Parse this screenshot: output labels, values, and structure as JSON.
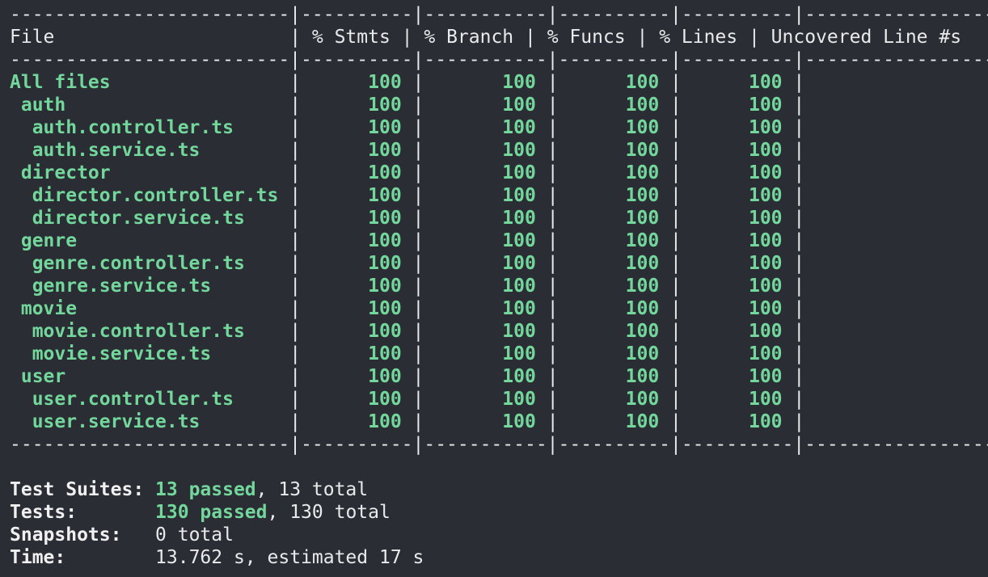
{
  "table": {
    "divider_file": "-------------------------",
    "divider_num": "----------",
    "divider_branch": "-----------",
    "divider_uncovered": "-------------------",
    "headers": {
      "file": "File",
      "stmts": "% Stmts",
      "branch": "% Branch",
      "funcs": "% Funcs",
      "lines": "% Lines",
      "uncovered": "Uncovered Line #s"
    },
    "rows": [
      {
        "file": "All files",
        "indent": 0,
        "stmts": "100",
        "branch": "100",
        "funcs": "100",
        "lines": "100",
        "uncovered": ""
      },
      {
        "file": "auth",
        "indent": 1,
        "stmts": "100",
        "branch": "100",
        "funcs": "100",
        "lines": "100",
        "uncovered": ""
      },
      {
        "file": "auth.controller.ts",
        "indent": 2,
        "stmts": "100",
        "branch": "100",
        "funcs": "100",
        "lines": "100",
        "uncovered": ""
      },
      {
        "file": "auth.service.ts",
        "indent": 2,
        "stmts": "100",
        "branch": "100",
        "funcs": "100",
        "lines": "100",
        "uncovered": ""
      },
      {
        "file": "director",
        "indent": 1,
        "stmts": "100",
        "branch": "100",
        "funcs": "100",
        "lines": "100",
        "uncovered": ""
      },
      {
        "file": "director.controller.ts",
        "indent": 2,
        "stmts": "100",
        "branch": "100",
        "funcs": "100",
        "lines": "100",
        "uncovered": ""
      },
      {
        "file": "director.service.ts",
        "indent": 2,
        "stmts": "100",
        "branch": "100",
        "funcs": "100",
        "lines": "100",
        "uncovered": ""
      },
      {
        "file": "genre",
        "indent": 1,
        "stmts": "100",
        "branch": "100",
        "funcs": "100",
        "lines": "100",
        "uncovered": ""
      },
      {
        "file": "genre.controller.ts",
        "indent": 2,
        "stmts": "100",
        "branch": "100",
        "funcs": "100",
        "lines": "100",
        "uncovered": ""
      },
      {
        "file": "genre.service.ts",
        "indent": 2,
        "stmts": "100",
        "branch": "100",
        "funcs": "100",
        "lines": "100",
        "uncovered": ""
      },
      {
        "file": "movie",
        "indent": 1,
        "stmts": "100",
        "branch": "100",
        "funcs": "100",
        "lines": "100",
        "uncovered": ""
      },
      {
        "file": "movie.controller.ts",
        "indent": 2,
        "stmts": "100",
        "branch": "100",
        "funcs": "100",
        "lines": "100",
        "uncovered": ""
      },
      {
        "file": "movie.service.ts",
        "indent": 2,
        "stmts": "100",
        "branch": "100",
        "funcs": "100",
        "lines": "100",
        "uncovered": ""
      },
      {
        "file": "user",
        "indent": 1,
        "stmts": "100",
        "branch": "100",
        "funcs": "100",
        "lines": "100",
        "uncovered": ""
      },
      {
        "file": "user.controller.ts",
        "indent": 2,
        "stmts": "100",
        "branch": "100",
        "funcs": "100",
        "lines": "100",
        "uncovered": ""
      },
      {
        "file": "user.service.ts",
        "indent": 2,
        "stmts": "100",
        "branch": "100",
        "funcs": "100",
        "lines": "100",
        "uncovered": ""
      }
    ]
  },
  "summary": {
    "suites_label": "Test Suites:",
    "suites_passed": "13 passed",
    "suites_total": ", 13 total",
    "tests_label": "Tests:",
    "tests_passed": "130 passed",
    "tests_total": ", 130 total",
    "snapshots_label": "Snapshots:",
    "snapshots_value": "0 total",
    "time_label": "Time:",
    "time_value": "13.762 s, estimated 17 s"
  },
  "colors": {
    "background": "#2a2d34",
    "text": "#e9eaeb",
    "pass_green": "#73d79c"
  }
}
